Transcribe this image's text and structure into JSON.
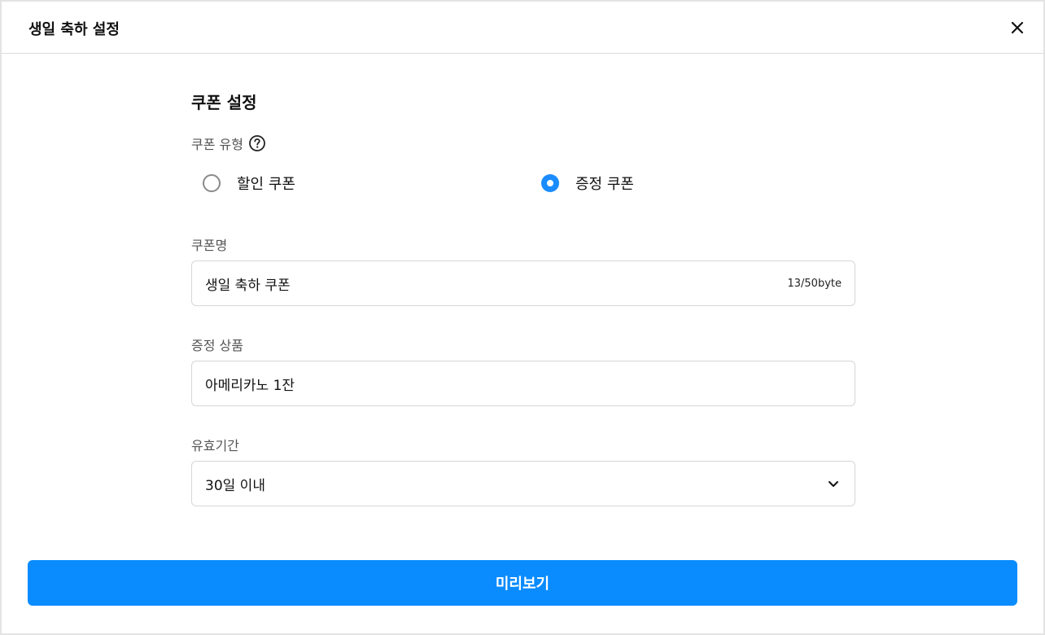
{
  "header": {
    "title": "생일 축하 설정"
  },
  "coupon": {
    "section_title": "쿠폰 설정",
    "type_label": "쿠폰 유형",
    "options": [
      {
        "label": "할인 쿠폰",
        "selected": false
      },
      {
        "label": "증정 쿠폰",
        "selected": true
      }
    ],
    "name_label": "쿠폰명",
    "name_value": "생일 축하 쿠폰",
    "name_counter": "13/50byte",
    "gift_label": "증정 상품",
    "gift_value": "아메리카노 1잔",
    "validity_label": "유효기간",
    "validity_value": "30일 이내"
  },
  "footer": {
    "preview_label": "미리보기"
  },
  "colors": {
    "accent": "#0a8cff"
  },
  "icons": {
    "close": "close-icon",
    "help": "help-circle-icon",
    "chevron": "chevron-down-icon"
  }
}
